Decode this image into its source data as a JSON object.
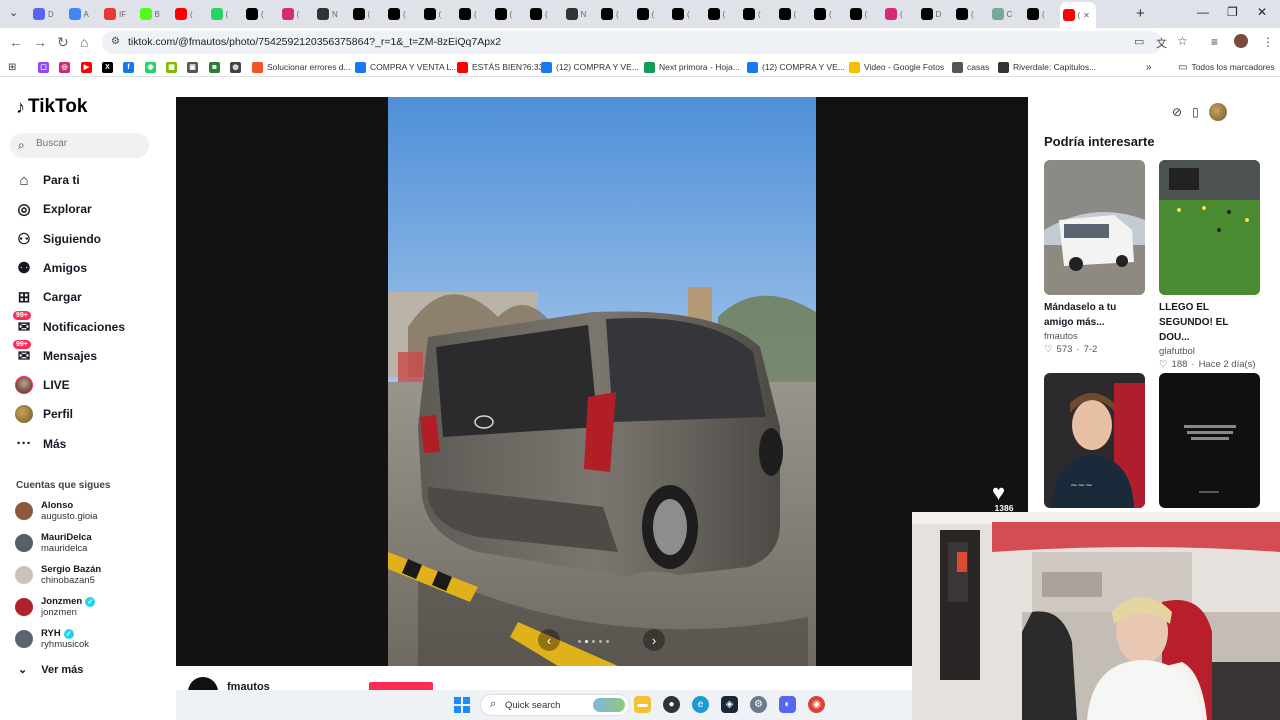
{
  "browser": {
    "url": "tiktok.com/@fmautos/photo/7542592120356375864?_r=1&_t=ZM-8zEiQq7Apx2",
    "tabs": [
      {
        "label": "D",
        "icon": "discord-icon",
        "color": "#5865f2"
      },
      {
        "label": "A",
        "icon": "google-icon",
        "color": "#4285f4"
      },
      {
        "label": "IF",
        "icon": "yandex-icon",
        "color": "#e53935"
      },
      {
        "label": "B",
        "icon": "kick-icon",
        "color": "#53fc18"
      },
      {
        "label": "(",
        "icon": "youtube-icon",
        "color": "#ff0000"
      },
      {
        "label": "(",
        "icon": "whatsapp-icon",
        "color": "#25d366"
      },
      {
        "label": "(",
        "icon": "x-icon",
        "color": "#000000"
      },
      {
        "label": "(",
        "icon": "instagram-icon",
        "color": "#d62976"
      },
      {
        "label": "N",
        "icon": "github-icon",
        "color": "#333333"
      },
      {
        "label": "(",
        "icon": "x-icon",
        "color": "#000000"
      },
      {
        "label": "(",
        "icon": "tiktok-icon",
        "color": "#000000"
      },
      {
        "label": "(",
        "icon": "tiktok-icon",
        "color": "#000000"
      },
      {
        "label": "(",
        "icon": "x-icon",
        "color": "#000000"
      },
      {
        "label": "(",
        "icon": "tiktok-icon",
        "color": "#000000"
      },
      {
        "label": "(",
        "icon": "tiktok-icon",
        "color": "#000000"
      },
      {
        "label": "N",
        "icon": "github-icon",
        "color": "#333333"
      },
      {
        "label": "(",
        "icon": "tiktok-icon",
        "color": "#000000"
      },
      {
        "label": "(",
        "icon": "tiktok-icon",
        "color": "#000000"
      },
      {
        "label": "(",
        "icon": "x-icon",
        "color": "#000000"
      },
      {
        "label": "(",
        "icon": "tiktok-icon",
        "color": "#000000"
      },
      {
        "label": "(",
        "icon": "tiktok-icon",
        "color": "#000000"
      },
      {
        "label": "(",
        "icon": "tiktok-icon",
        "color": "#000000"
      },
      {
        "label": "(",
        "icon": "tiktok-icon",
        "color": "#000000"
      },
      {
        "label": "(",
        "icon": "x-icon",
        "color": "#000000"
      },
      {
        "label": "(",
        "icon": "instagram-icon",
        "color": "#d62976"
      },
      {
        "label": "D",
        "icon": "tiktok-icon",
        "color": "#000000"
      },
      {
        "label": "(",
        "icon": "tiktok-icon",
        "color": "#000000"
      },
      {
        "label": "C",
        "icon": "chatgpt-icon",
        "color": "#74aa9c"
      },
      {
        "label": "(",
        "icon": "x-icon",
        "color": "#000000"
      },
      {
        "label": "(",
        "icon": "youtube-icon",
        "color": "#ff0000"
      }
    ],
    "bookmarks": [
      {
        "label": "Solucionar errores d...",
        "icon": "windows-icon",
        "color": "#f35325"
      },
      {
        "label": "COMPRA Y VENTA L...",
        "icon": "facebook-icon",
        "color": "#1877f2"
      },
      {
        "label": "ESTÁS BIEN?6:33",
        "icon": "youtube-icon",
        "color": "#ff0000"
      },
      {
        "label": "(12) COMPRA Y VE...",
        "icon": "facebook-icon",
        "color": "#1877f2"
      },
      {
        "label": "Next primora - Hoja...",
        "icon": "sheets-icon",
        "color": "#0f9d58"
      },
      {
        "label": "(12) COMPRA Y VE...",
        "icon": "facebook-icon",
        "color": "#1877f2"
      },
      {
        "label": "Video - Google Fotos",
        "icon": "photos-icon",
        "color": "#fbbc04"
      },
      {
        "label": "casas",
        "icon": "folder-icon",
        "color": "#555555"
      },
      {
        "label": "Riverdale: Capitulos...",
        "icon": "riverdale-icon",
        "color": "#333333"
      }
    ],
    "all_bookmarks": "Todos los marcadores"
  },
  "tiktok": {
    "logo": "TikTok",
    "search_placeholder": "Buscar",
    "nav": [
      {
        "label": "Para ti",
        "icon": "home-icon"
      },
      {
        "label": "Explorar",
        "icon": "compass-icon"
      },
      {
        "label": "Siguiendo",
        "icon": "following-icon"
      },
      {
        "label": "Amigos",
        "icon": "friends-icon"
      },
      {
        "label": "Cargar",
        "icon": "upload-icon"
      },
      {
        "label": "Notificaciones",
        "icon": "notifications-icon",
        "badge": "99+"
      },
      {
        "label": "Mensajes",
        "icon": "messages-icon",
        "badge": "99+"
      },
      {
        "label": "LIVE",
        "icon": "live-icon"
      },
      {
        "label": "Perfil",
        "icon": "profile-icon"
      },
      {
        "label": "Más",
        "icon": "more-icon"
      }
    ],
    "following_heading": "Cuentas que sigues",
    "following": [
      {
        "name": "Alonso",
        "username": "augusto.gioia",
        "verified": false
      },
      {
        "name": "MauriDelca",
        "username": "mauridelca",
        "verified": false
      },
      {
        "name": "Sergio Bazán",
        "username": "chinobazan5",
        "verified": false
      },
      {
        "name": "Jonzmen",
        "username": "jonzmen",
        "verified": true
      },
      {
        "name": "RYH",
        "username": "ryhmusicok",
        "verified": true
      }
    ],
    "see_more": "Ver más",
    "post": {
      "author": "fmautos",
      "likes": "1386"
    },
    "suggestions_title": "Podría interesarte",
    "suggestions": [
      {
        "title": "Mándaselo a tu amigo más...",
        "author": "fmautos",
        "likes": "573",
        "date": "7-2"
      },
      {
        "title": "LLEGO EL SEGUNDO! EL DOU...",
        "author": "glafutbol",
        "likes": "188",
        "date": "Hace 2 día(s)"
      },
      {
        "title": "",
        "author": "",
        "likes": "",
        "date": ""
      },
      {
        "title": "",
        "author": "",
        "likes": "",
        "date": ""
      }
    ]
  },
  "taskbar": {
    "search_label": "Quick search"
  },
  "colors": {
    "brand_pink": "#fe2c55",
    "verified": "#20d5ec",
    "viewer_bg": "#121212"
  }
}
